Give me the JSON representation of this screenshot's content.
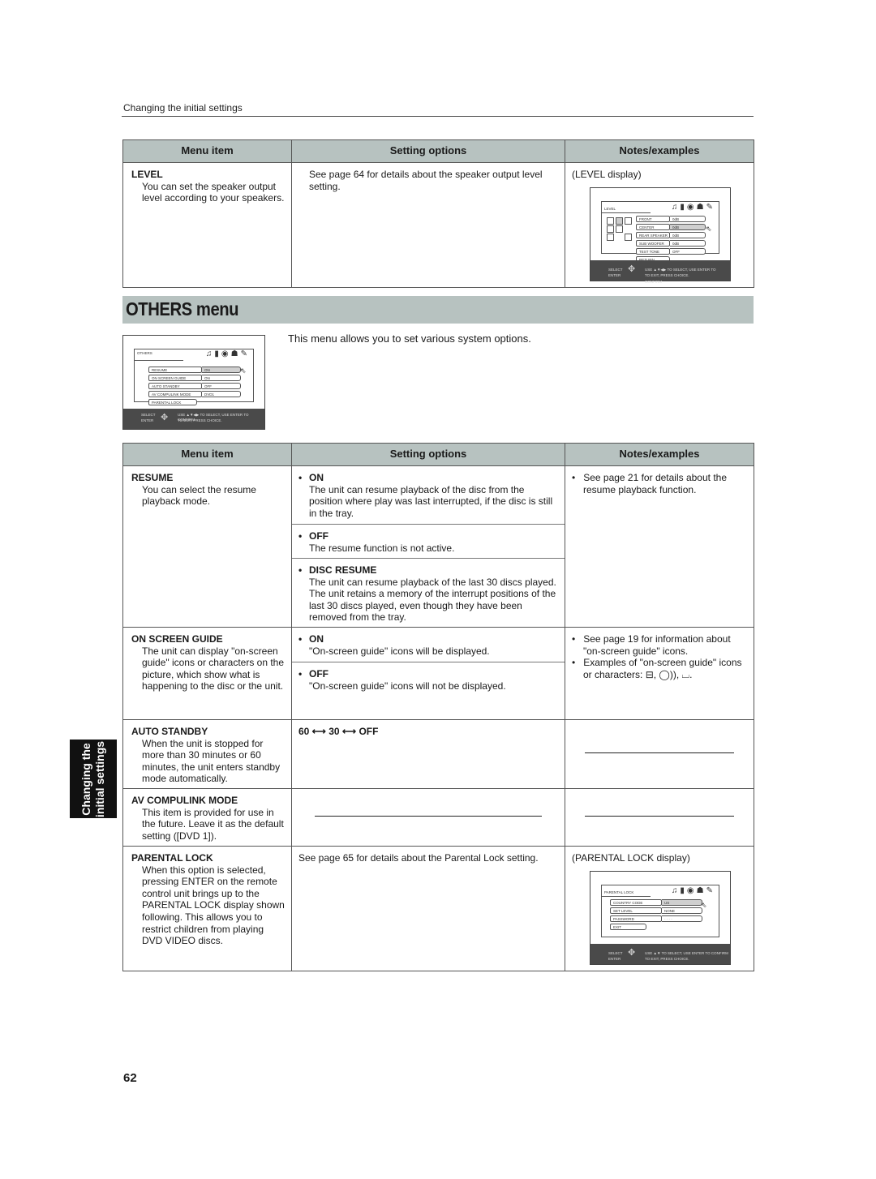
{
  "running_head": "Changing the initial settings",
  "table_headers": {
    "menu_item": "Menu item",
    "setting_options": "Setting options",
    "notes_examples": "Notes/examples"
  },
  "level_row": {
    "title": "LEVEL",
    "desc": "You can set the speaker output level according to your speakers.",
    "option": "See page 64 for details about the speaker output level setting.",
    "note": "(LEVEL display)"
  },
  "level_screen": {
    "tab_label": "LEVEL",
    "rows": [
      {
        "label": "FRONT SPEAKER",
        "value": "0dB"
      },
      {
        "label": "CENTER SPEAKER",
        "value": "0dB"
      },
      {
        "label": "REAR SPEAKER",
        "value": "0dB"
      },
      {
        "label": "SUB WOOFER",
        "value": "0dB"
      },
      {
        "label": "TEST TONE",
        "value": "OFF"
      },
      {
        "label": "RETURN",
        "value": ""
      }
    ],
    "footer_select": "SELECT",
    "footer_enter": "ENTER",
    "footer_line1": "USE ▲▼◀▶ TO SELECT, USE ENTER TO CONFIRM",
    "footer_line2": "TO EXIT, PRESS CHOICE."
  },
  "section": {
    "title": "OTHERS menu",
    "intro": "This menu allows you to set various system options."
  },
  "others_screen": {
    "tab_label": "OTHERS",
    "rows": [
      {
        "label": "RESUME",
        "value": "ON"
      },
      {
        "label": "ON SCREEN GUIDE",
        "value": "ON"
      },
      {
        "label": "AUTO STANDBY",
        "value": "OFF"
      },
      {
        "label": "AV COMPULINK MODE",
        "value": "DVD1"
      },
      {
        "label": "PARENTAL LOCK",
        "value": ""
      }
    ],
    "footer_select": "SELECT",
    "footer_enter": "ENTER",
    "footer_line1": "USE ▲▼◀▶ TO SELECT, USE ENTER TO CONFIRM",
    "footer_line2": "TO EXIT, PRESS CHOICE."
  },
  "rows": {
    "resume": {
      "title": "RESUME",
      "desc": "You can select the resume playback mode.",
      "options": [
        {
          "head": "ON",
          "text": "The unit can resume playback of the disc from the position where play was last interrupted, if the disc is still in the tray."
        },
        {
          "head": "OFF",
          "text": "The resume function is not active."
        },
        {
          "head": "DISC RESUME",
          "text": "The unit can resume playback of the last 30 discs played. The unit retains a memory of the interrupt positions of the last 30 discs played, even though they have been removed from the tray."
        }
      ],
      "notes": [
        "See page 21 for details about the resume playback function."
      ]
    },
    "on_screen_guide": {
      "title": "ON SCREEN GUIDE",
      "desc": "The unit can display \"on-screen guide\" icons or characters on the picture, which show what is happening to the disc or the unit.",
      "options": [
        {
          "head": "ON",
          "text": "\"On-screen guide\" icons will be displayed."
        },
        {
          "head": "OFF",
          "text": "\"On-screen guide\" icons will not be displayed."
        }
      ],
      "notes": [
        "See page 19 for information about \"on-screen guide\" icons.",
        "Examples of \"on-screen guide\" icons or characters: ⊟, ◯)), ⌴."
      ]
    },
    "auto_standby": {
      "title": "AUTO STANDBY",
      "desc": "When the unit is stopped for more than 30 minutes or 60 minutes, the unit enters standby mode automatically.",
      "option": "60 ⟷ 30 ⟷ OFF"
    },
    "av_compulink": {
      "title": "AV COMPULINK MODE",
      "desc": "This item is provided for use in the future. Leave it as the default setting ([DVD 1])."
    },
    "parental_lock": {
      "title": "PARENTAL LOCK",
      "desc": "When this option is selected, pressing ENTER on the remote control unit brings up to the PARENTAL LOCK display shown following. This allows you to restrict children from playing DVD VIDEO discs.",
      "option": "See page 65 for details about the Parental Lock setting.",
      "note": "(PARENTAL LOCK display)"
    }
  },
  "parental_screen": {
    "tab_label": "PARENTAL LOCK",
    "rows": [
      {
        "label": "COUNTRY CODE",
        "value": "US"
      },
      {
        "label": "SET LEVEL",
        "value": "NONE"
      },
      {
        "label": "PASSWORD",
        "value": "- - - -"
      },
      {
        "label": "EXIT",
        "value": ""
      }
    ],
    "footer_select": "SELECT",
    "footer_enter": "ENTER",
    "footer_line1": "USE ▲▼ TO SELECT, USE ENTER TO CONFIRM",
    "footer_line2": "TO EXIT, PRESS CHOICE."
  },
  "side_tab": {
    "line1": "Changing the",
    "line2": "initial settings"
  },
  "page_number": "62",
  "icons": {
    "tab_icons": "♫▮◉☗✎",
    "cursor": "⇖",
    "pad": "✥"
  }
}
